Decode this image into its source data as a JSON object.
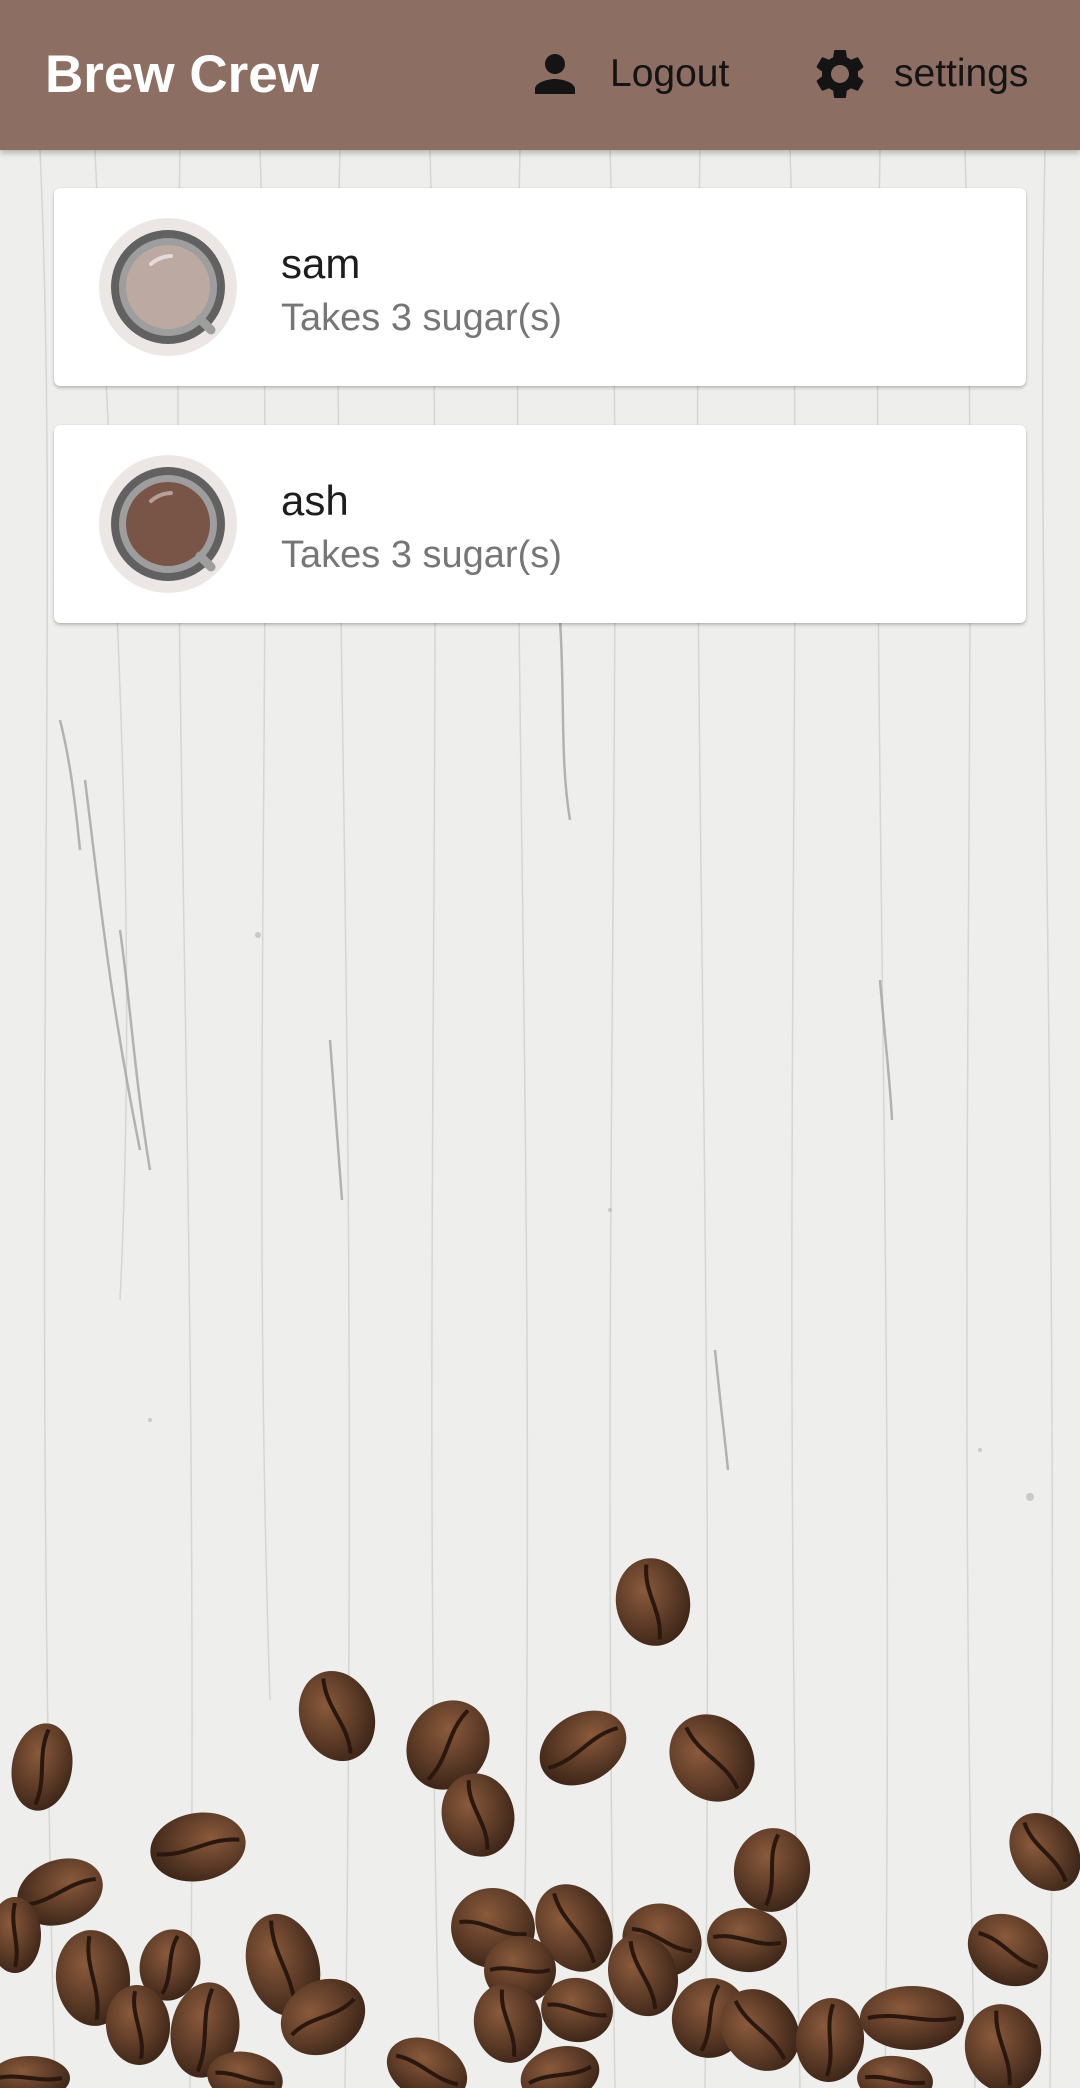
{
  "app_bar": {
    "title": "Brew Crew",
    "background_color": "#8d6e63",
    "actions": [
      {
        "label": "Logout",
        "icon": "person-icon"
      },
      {
        "label": "settings",
        "icon": "gear-icon"
      }
    ]
  },
  "brews": [
    {
      "name": "sam",
      "subtitle": "Takes 3 sugar(s)",
      "icon": "coffee-cup-icon",
      "coffee_color": "#bca9a2"
    },
    {
      "name": "ash",
      "subtitle": "Takes 3 sugar(s)",
      "icon": "coffee-cup-icon",
      "coffee_color": "#795548"
    }
  ],
  "background": {
    "surface": "white-wood-texture",
    "decoration": "coffee-beans",
    "bean_color": "#5b3a26"
  }
}
